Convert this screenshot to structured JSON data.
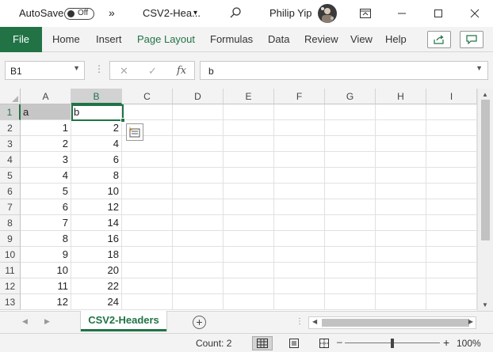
{
  "titlebar": {
    "autosave_label": "AutoSave",
    "autosave_state": "Off",
    "more": "»",
    "filename": "CSV2-Hea...",
    "filename_dropdown": "▾",
    "user_name": "Philip Yip",
    "icons": {
      "search": "search-icon",
      "ribbon_display": "ribbon-display-icon",
      "minimize": "minimize-icon",
      "maximize": "maximize-icon",
      "close": "close-icon"
    }
  },
  "ribbon": {
    "tabs": [
      "File",
      "Home",
      "Insert",
      "Page Layout",
      "Formulas",
      "Data",
      "Review",
      "View",
      "Help"
    ],
    "active_tab": "Page Layout",
    "accent": "#217346"
  },
  "formula_bar": {
    "name_box": "B1",
    "content": "b",
    "fx": "fx"
  },
  "grid": {
    "columns": [
      "A",
      "B",
      "C",
      "D",
      "E",
      "F",
      "G",
      "H",
      "I"
    ],
    "row_numbers": [
      "1",
      "2",
      "3",
      "4",
      "5",
      "6",
      "7",
      "8",
      "9",
      "10",
      "11",
      "12",
      "13"
    ],
    "col_a": [
      "a",
      "1",
      "2",
      "3",
      "4",
      "5",
      "6",
      "7",
      "8",
      "9",
      "10",
      "11",
      "12"
    ],
    "col_b": [
      "b",
      "2",
      "4",
      "6",
      "8",
      "10",
      "12",
      "14",
      "16",
      "18",
      "20",
      "22",
      "24"
    ],
    "selected_cell": "B1"
  },
  "sheets": {
    "tabs": [
      "CSV2-Headers"
    ],
    "active": "CSV2-Headers",
    "add_label": "+"
  },
  "statusbar": {
    "count": "Count: 2",
    "zoom_minus": "–",
    "zoom_plus": "+",
    "zoom_level": "100%",
    "zoom_fraction": 0.5
  }
}
